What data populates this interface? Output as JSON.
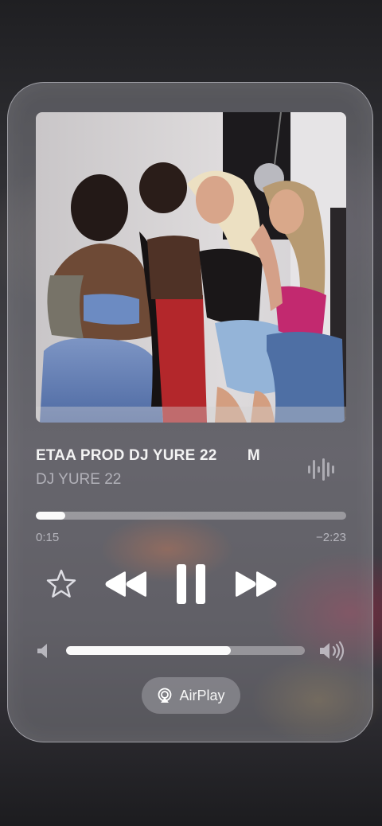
{
  "now_playing": {
    "title": "ETAA PROD DJ YURE 22       M",
    "artist": "DJ YURE 22",
    "elapsed": "0:15",
    "remaining": "−2:23",
    "progress": 0.095
  },
  "controls": {
    "favorite_icon": "star-icon",
    "previous_icon": "rewind-icon",
    "play_pause_icon": "pause-icon",
    "next_icon": "fast-forward-icon"
  },
  "volume": {
    "level": 0.69,
    "low_icon": "speaker-low-icon",
    "high_icon": "speaker-high-icon"
  },
  "airplay": {
    "label": "AirPlay",
    "icon": "airplay-icon"
  },
  "colors": {
    "card": "#96969e",
    "fill": "#ffffff"
  }
}
